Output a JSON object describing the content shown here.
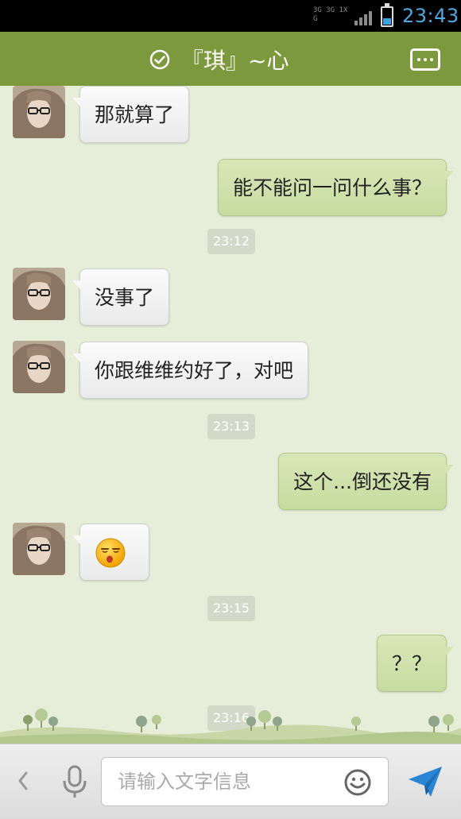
{
  "status_bar": {
    "network_line1": "3G 3G 1X G",
    "time": "23:43",
    "battery_level": 0.35
  },
  "header": {
    "title": "『琪』~心",
    "accent_color": "#7c9a3d"
  },
  "messages": [
    {
      "from": "contact",
      "text": "那就算了"
    },
    {
      "from": "me",
      "text": "能不能问一问什么事？"
    },
    {
      "type": "timestamp",
      "text": "23:12"
    },
    {
      "from": "contact",
      "text": "没事了"
    },
    {
      "from": "contact",
      "text": "你跟维维约好了，对吧"
    },
    {
      "type": "timestamp",
      "text": "23:13"
    },
    {
      "from": "me",
      "text": "这个...倒还没有"
    },
    {
      "from": "contact",
      "emoji": "drowsy-face-emoji"
    },
    {
      "type": "timestamp",
      "text": "23:15"
    },
    {
      "from": "me",
      "text": "？？"
    },
    {
      "type": "timestamp",
      "text": "23:16"
    }
  ],
  "input_bar": {
    "placeholder": "请输入文字信息"
  },
  "icons": {
    "verified": "check-circle-icon",
    "more": "more-icon",
    "back": "chevron-left-icon",
    "mic": "microphone-icon",
    "smiley": "smiley-icon",
    "send": "send-icon"
  }
}
